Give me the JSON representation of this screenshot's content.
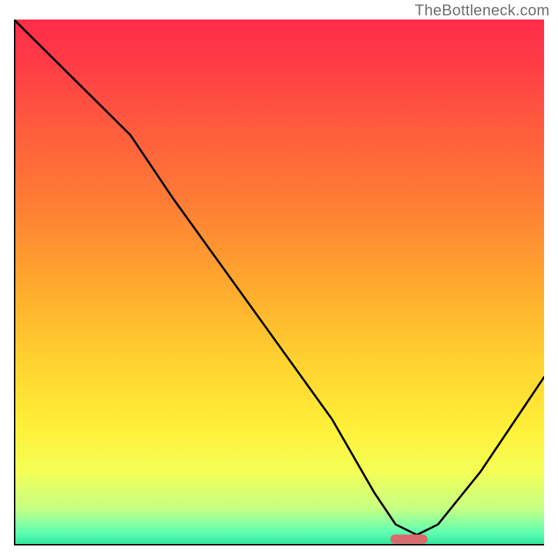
{
  "watermark": "TheBottleneck.com",
  "chart_data": {
    "type": "line",
    "title": "",
    "xlabel": "",
    "ylabel": "",
    "xlim": [
      0,
      100
    ],
    "ylim": [
      0,
      100
    ],
    "grid": false,
    "legend": false,
    "curve": {
      "name": "curve",
      "x": [
        0,
        12,
        22,
        30,
        40,
        50,
        60,
        68,
        72,
        76,
        80,
        88,
        96,
        100
      ],
      "y": [
        100,
        88,
        78,
        66,
        52,
        38,
        24,
        10,
        4,
        2,
        4,
        14,
        26,
        32
      ]
    },
    "marker": {
      "name": "marker",
      "x_center": 74.5,
      "y_center": 1.2,
      "width": 7,
      "height": 1.8,
      "color": "#d86a6d"
    },
    "gradient_stops": [
      {
        "offset": 0.0,
        "color": "#ff2c49"
      },
      {
        "offset": 0.08,
        "color": "#ff3b47"
      },
      {
        "offset": 0.2,
        "color": "#ff5a3e"
      },
      {
        "offset": 0.35,
        "color": "#ff7d35"
      },
      {
        "offset": 0.5,
        "color": "#ffa82e"
      },
      {
        "offset": 0.65,
        "color": "#ffd22f"
      },
      {
        "offset": 0.78,
        "color": "#fff03a"
      },
      {
        "offset": 0.86,
        "color": "#f3ff56"
      },
      {
        "offset": 0.93,
        "color": "#c6ff83"
      },
      {
        "offset": 0.975,
        "color": "#5fffb2"
      },
      {
        "offset": 1.0,
        "color": "#2be39b"
      }
    ],
    "axis_color": "#000000",
    "curve_color": "#000000"
  }
}
